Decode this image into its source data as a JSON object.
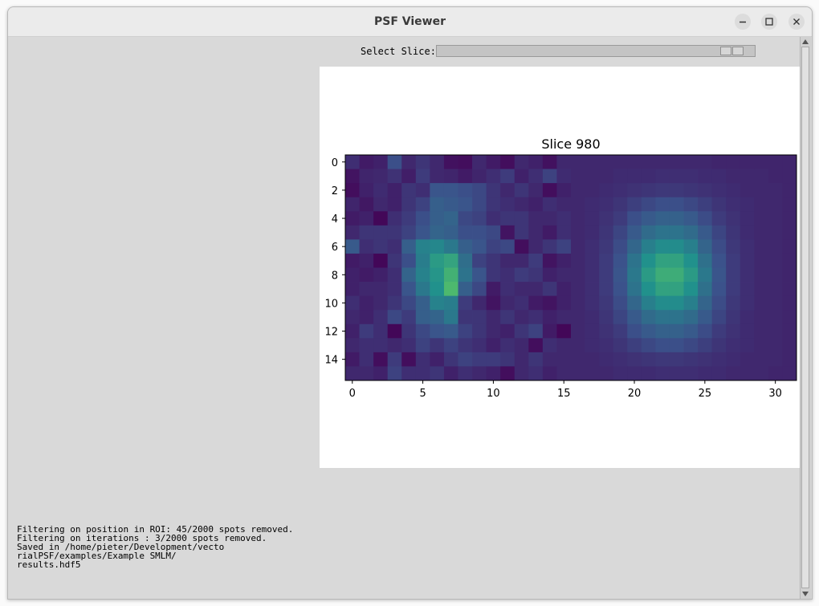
{
  "window": {
    "title": "PSF Viewer",
    "buttons": {
      "minimize_icon": "minimize-icon",
      "maximize_icon": "maximize-icon",
      "close_icon": "close-icon"
    }
  },
  "controls": {
    "slice_label": "Select Slice:",
    "slider_value_fraction": 0.96
  },
  "log": {
    "lines": [
      "Filtering on position in ROI: 45/2000 spots removed.",
      "Filtering on iterations : 3/2000 spots removed.",
      "Saved in /home/pieter/Development/vecto",
      "rialPSF/examples/Example SMLM/",
      "results.hdf5"
    ]
  },
  "chart_data": {
    "type": "heatmap",
    "title": "Slice 980",
    "xlabel": "",
    "ylabel": "",
    "colormap": "viridis",
    "xlim": [
      -0.5,
      31.5
    ],
    "ylim": [
      15.5,
      -0.5
    ],
    "x_ticks": [
      0,
      5,
      10,
      15,
      20,
      25,
      30
    ],
    "y_ticks": [
      0,
      2,
      4,
      6,
      8,
      10,
      12,
      14
    ],
    "x_tick_labels": [
      "0",
      "5",
      "10",
      "15",
      "20",
      "25",
      "30"
    ],
    "y_tick_labels": [
      "0",
      "2",
      "4",
      "6",
      "8",
      "10",
      "12",
      "14"
    ],
    "shape": [
      16,
      32
    ],
    "vmin": 0,
    "vmax": 1,
    "values": [
      [
        0.14,
        0.08,
        0.1,
        0.24,
        0.12,
        0.16,
        0.12,
        0.05,
        0.04,
        0.12,
        0.08,
        0.04,
        0.12,
        0.1,
        0.05,
        0.12,
        0.12,
        0.12,
        0.12,
        0.12,
        0.12,
        0.12,
        0.12,
        0.12,
        0.12,
        0.12,
        0.11,
        0.11,
        0.11,
        0.11,
        0.11,
        0.11
      ],
      [
        0.06,
        0.11,
        0.12,
        0.15,
        0.09,
        0.18,
        0.12,
        0.11,
        0.08,
        0.11,
        0.14,
        0.18,
        0.1,
        0.14,
        0.2,
        0.13,
        0.12,
        0.12,
        0.12,
        0.13,
        0.13,
        0.13,
        0.14,
        0.14,
        0.14,
        0.13,
        0.13,
        0.12,
        0.12,
        0.12,
        0.11,
        0.11
      ],
      [
        0.04,
        0.1,
        0.13,
        0.1,
        0.16,
        0.14,
        0.26,
        0.26,
        0.24,
        0.22,
        0.16,
        0.12,
        0.16,
        0.12,
        0.04,
        0.1,
        0.12,
        0.12,
        0.13,
        0.14,
        0.15,
        0.16,
        0.17,
        0.17,
        0.16,
        0.15,
        0.14,
        0.13,
        0.12,
        0.12,
        0.12,
        0.11
      ],
      [
        0.11,
        0.07,
        0.12,
        0.1,
        0.16,
        0.2,
        0.3,
        0.28,
        0.26,
        0.22,
        0.16,
        0.14,
        0.12,
        0.1,
        0.14,
        0.12,
        0.12,
        0.13,
        0.14,
        0.16,
        0.19,
        0.22,
        0.24,
        0.24,
        0.22,
        0.19,
        0.16,
        0.14,
        0.13,
        0.12,
        0.12,
        0.11
      ],
      [
        0.08,
        0.1,
        0.02,
        0.14,
        0.18,
        0.24,
        0.3,
        0.32,
        0.22,
        0.2,
        0.14,
        0.16,
        0.16,
        0.12,
        0.12,
        0.14,
        0.12,
        0.13,
        0.15,
        0.18,
        0.24,
        0.28,
        0.31,
        0.31,
        0.28,
        0.23,
        0.18,
        0.15,
        0.13,
        0.12,
        0.12,
        0.11
      ],
      [
        0.12,
        0.16,
        0.16,
        0.16,
        0.2,
        0.26,
        0.32,
        0.3,
        0.24,
        0.24,
        0.22,
        0.06,
        0.16,
        0.12,
        0.08,
        0.14,
        0.12,
        0.13,
        0.16,
        0.21,
        0.28,
        0.35,
        0.38,
        0.38,
        0.35,
        0.28,
        0.21,
        0.16,
        0.13,
        0.12,
        0.12,
        0.11
      ],
      [
        0.28,
        0.14,
        0.16,
        0.14,
        0.3,
        0.44,
        0.46,
        0.4,
        0.3,
        0.26,
        0.2,
        0.22,
        0.04,
        0.12,
        0.16,
        0.2,
        0.12,
        0.14,
        0.17,
        0.23,
        0.33,
        0.43,
        0.48,
        0.48,
        0.43,
        0.32,
        0.23,
        0.17,
        0.14,
        0.12,
        0.12,
        0.11
      ],
      [
        0.08,
        0.1,
        0.02,
        0.16,
        0.24,
        0.42,
        0.54,
        0.58,
        0.36,
        0.2,
        0.16,
        0.12,
        0.12,
        0.18,
        0.06,
        0.1,
        0.12,
        0.14,
        0.18,
        0.25,
        0.38,
        0.5,
        0.57,
        0.57,
        0.5,
        0.37,
        0.25,
        0.18,
        0.14,
        0.12,
        0.12,
        0.11
      ],
      [
        0.1,
        0.08,
        0.1,
        0.14,
        0.32,
        0.44,
        0.52,
        0.64,
        0.38,
        0.26,
        0.16,
        0.14,
        0.18,
        0.16,
        0.1,
        0.12,
        0.12,
        0.14,
        0.18,
        0.26,
        0.4,
        0.54,
        0.62,
        0.62,
        0.54,
        0.4,
        0.26,
        0.18,
        0.14,
        0.12,
        0.12,
        0.11
      ],
      [
        0.1,
        0.12,
        0.12,
        0.14,
        0.26,
        0.4,
        0.5,
        0.68,
        0.3,
        0.22,
        0.08,
        0.14,
        0.12,
        0.12,
        0.16,
        0.1,
        0.12,
        0.14,
        0.18,
        0.25,
        0.38,
        0.5,
        0.57,
        0.57,
        0.5,
        0.37,
        0.25,
        0.18,
        0.14,
        0.12,
        0.12,
        0.11
      ],
      [
        0.14,
        0.1,
        0.12,
        0.16,
        0.22,
        0.3,
        0.44,
        0.42,
        0.18,
        0.12,
        0.06,
        0.12,
        0.14,
        0.08,
        0.06,
        0.1,
        0.12,
        0.14,
        0.17,
        0.23,
        0.33,
        0.43,
        0.48,
        0.48,
        0.43,
        0.32,
        0.23,
        0.17,
        0.14,
        0.12,
        0.12,
        0.11
      ],
      [
        0.12,
        0.1,
        0.14,
        0.22,
        0.18,
        0.3,
        0.32,
        0.4,
        0.16,
        0.16,
        0.12,
        0.16,
        0.12,
        0.14,
        0.1,
        0.12,
        0.12,
        0.13,
        0.16,
        0.21,
        0.28,
        0.35,
        0.38,
        0.38,
        0.35,
        0.28,
        0.21,
        0.16,
        0.13,
        0.12,
        0.12,
        0.11
      ],
      [
        0.1,
        0.18,
        0.14,
        0.02,
        0.16,
        0.22,
        0.26,
        0.28,
        0.2,
        0.16,
        0.12,
        0.1,
        0.16,
        0.2,
        0.08,
        0.02,
        0.12,
        0.13,
        0.15,
        0.18,
        0.24,
        0.28,
        0.31,
        0.31,
        0.28,
        0.23,
        0.18,
        0.15,
        0.13,
        0.12,
        0.12,
        0.11
      ],
      [
        0.12,
        0.14,
        0.14,
        0.12,
        0.14,
        0.2,
        0.16,
        0.2,
        0.16,
        0.14,
        0.1,
        0.14,
        0.12,
        0.04,
        0.14,
        0.12,
        0.12,
        0.13,
        0.14,
        0.16,
        0.19,
        0.22,
        0.24,
        0.24,
        0.22,
        0.19,
        0.16,
        0.14,
        0.13,
        0.12,
        0.12,
        0.11
      ],
      [
        0.08,
        0.14,
        0.04,
        0.18,
        0.04,
        0.14,
        0.1,
        0.16,
        0.2,
        0.18,
        0.18,
        0.16,
        0.12,
        0.16,
        0.12,
        0.12,
        0.12,
        0.12,
        0.13,
        0.14,
        0.15,
        0.16,
        0.17,
        0.17,
        0.16,
        0.15,
        0.14,
        0.13,
        0.12,
        0.12,
        0.12,
        0.11
      ],
      [
        0.12,
        0.12,
        0.1,
        0.2,
        0.14,
        0.14,
        0.16,
        0.1,
        0.14,
        0.12,
        0.1,
        0.04,
        0.12,
        0.14,
        0.1,
        0.12,
        0.12,
        0.12,
        0.12,
        0.13,
        0.13,
        0.13,
        0.14,
        0.14,
        0.14,
        0.13,
        0.13,
        0.12,
        0.12,
        0.12,
        0.11,
        0.11
      ]
    ]
  }
}
